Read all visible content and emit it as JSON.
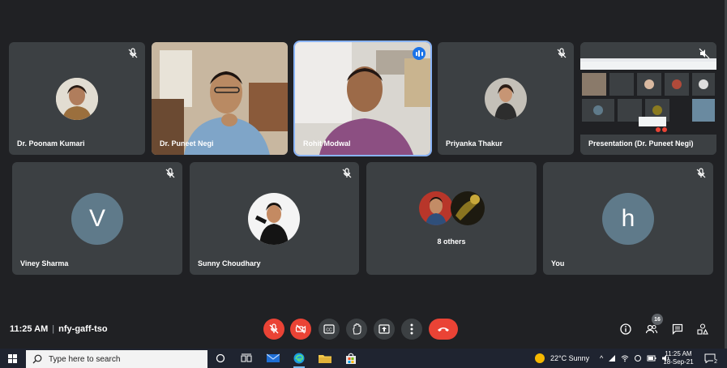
{
  "participants": {
    "poonam": {
      "name": "Dr. Poonam Kumari",
      "muted": true
    },
    "puneet": {
      "name": "Dr. Puneet Negi"
    },
    "rohit": {
      "name": "Rohit Modwal",
      "speaking": true
    },
    "priyanka": {
      "name": "Priyanka Thakur",
      "muted": true
    },
    "presentation": {
      "name": "Presentation (Dr. Puneet Negi)",
      "muted": true
    },
    "viney": {
      "name": "Viney Sharma",
      "initial": "V",
      "muted": true
    },
    "sunny": {
      "name": "Sunny Choudhary",
      "muted": true
    },
    "others": {
      "label": "8 others"
    },
    "you": {
      "name": "You",
      "initial": "h",
      "muted": true
    }
  },
  "toolbar": {
    "time": "11:25 AM",
    "meeting_code": "nfy-gaff-tso",
    "people_count": "16"
  },
  "icons": {
    "mic": "mic-off-icon",
    "camera": "camera-off-icon",
    "captions": "captions-icon",
    "hand": "raise-hand-icon",
    "present": "present-screen-icon",
    "more": "more-options-icon",
    "end": "end-call-icon",
    "info": "info-icon",
    "people": "people-icon",
    "chat": "chat-icon",
    "activities": "activities-icon"
  },
  "colors": {
    "background": "#202124",
    "tile": "#3c4043",
    "red": "#ea4335",
    "active_speaker": "#8ab4f8",
    "speaking_badge": "#1a73e8"
  },
  "taskbar": {
    "search_placeholder": "Type here to search",
    "weather": "22°C  Sunny",
    "clock_time": "11:25 AM",
    "clock_date": "18-Sep-21",
    "notification_count": "2"
  }
}
